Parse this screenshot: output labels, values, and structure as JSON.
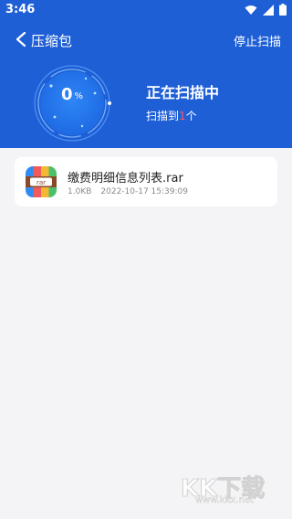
{
  "status_bar": {
    "time": "3:46"
  },
  "header": {
    "title": "压缩包",
    "stop_label": "停止扫描",
    "progress_percent": 0,
    "progress_number": "0",
    "progress_unit": "%",
    "scan_title": "正在扫描中",
    "scan_prefix": "扫描到",
    "scan_count": "1",
    "scan_suffix": "个"
  },
  "files": [
    {
      "name": "缴费明细信息列表.rar",
      "size": "1.0KB",
      "date": "2022-10-17 15:39:09",
      "icon": "rar-archive-icon",
      "icon_text": "rar"
    }
  ],
  "watermark": {
    "big": "KK下载",
    "small": "www.kkx.net"
  },
  "colors": {
    "header_bg": "#1f5fd6",
    "page_bg": "#f4f4f6",
    "count_highlight": "#ff5a5a"
  }
}
